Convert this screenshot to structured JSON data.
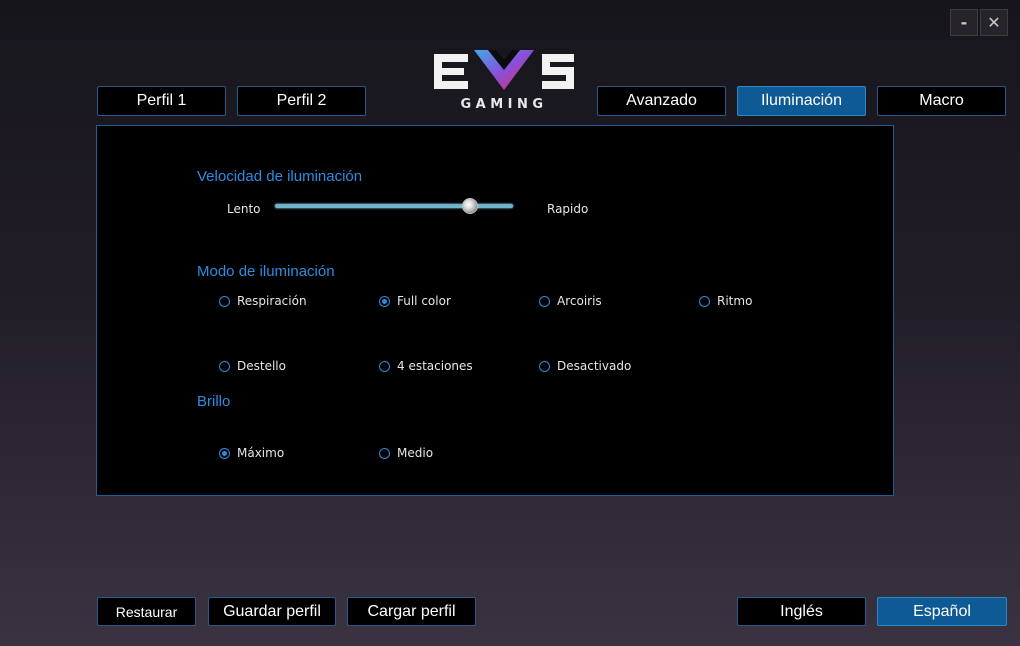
{
  "window": {
    "minimize_label": "-",
    "close_label": "✕"
  },
  "logo": {
    "text": "GAMING",
    "mark": "EVS"
  },
  "tabs": [
    {
      "label": "Perfil 1"
    },
    {
      "label": "Perfil 2"
    },
    {
      "label": "Avanzado"
    },
    {
      "label": "Iluminación",
      "active": true
    },
    {
      "label": "Macro"
    }
  ],
  "speed": {
    "title": "Velocidad de iluminación",
    "min_label": "Lento",
    "max_label": "Rapido",
    "value_fraction": 0.82
  },
  "mode": {
    "title": "Modo de iluminación",
    "options": [
      {
        "label": "Respiración",
        "selected": false
      },
      {
        "label": "Full color",
        "selected": true
      },
      {
        "label": "Arcoiris",
        "selected": false
      },
      {
        "label": "Ritmo",
        "selected": false
      },
      {
        "label": "Destello",
        "selected": false
      },
      {
        "label": "4 estaciones",
        "selected": false
      },
      {
        "label": "Desactivado",
        "selected": false
      }
    ]
  },
  "brightness": {
    "title": "Brillo",
    "options": [
      {
        "label": "Máximo",
        "selected": true
      },
      {
        "label": "Medio",
        "selected": false
      }
    ]
  },
  "bottom": {
    "restore": "Restaurar",
    "save_profile": "Guardar perfil",
    "load_profile": "Cargar perfil",
    "english": "Inglés",
    "spanish": "Español"
  },
  "colors": {
    "accent": "#2d8ce0",
    "active_button": "#0e5a94",
    "border": "#2a5a8c"
  }
}
